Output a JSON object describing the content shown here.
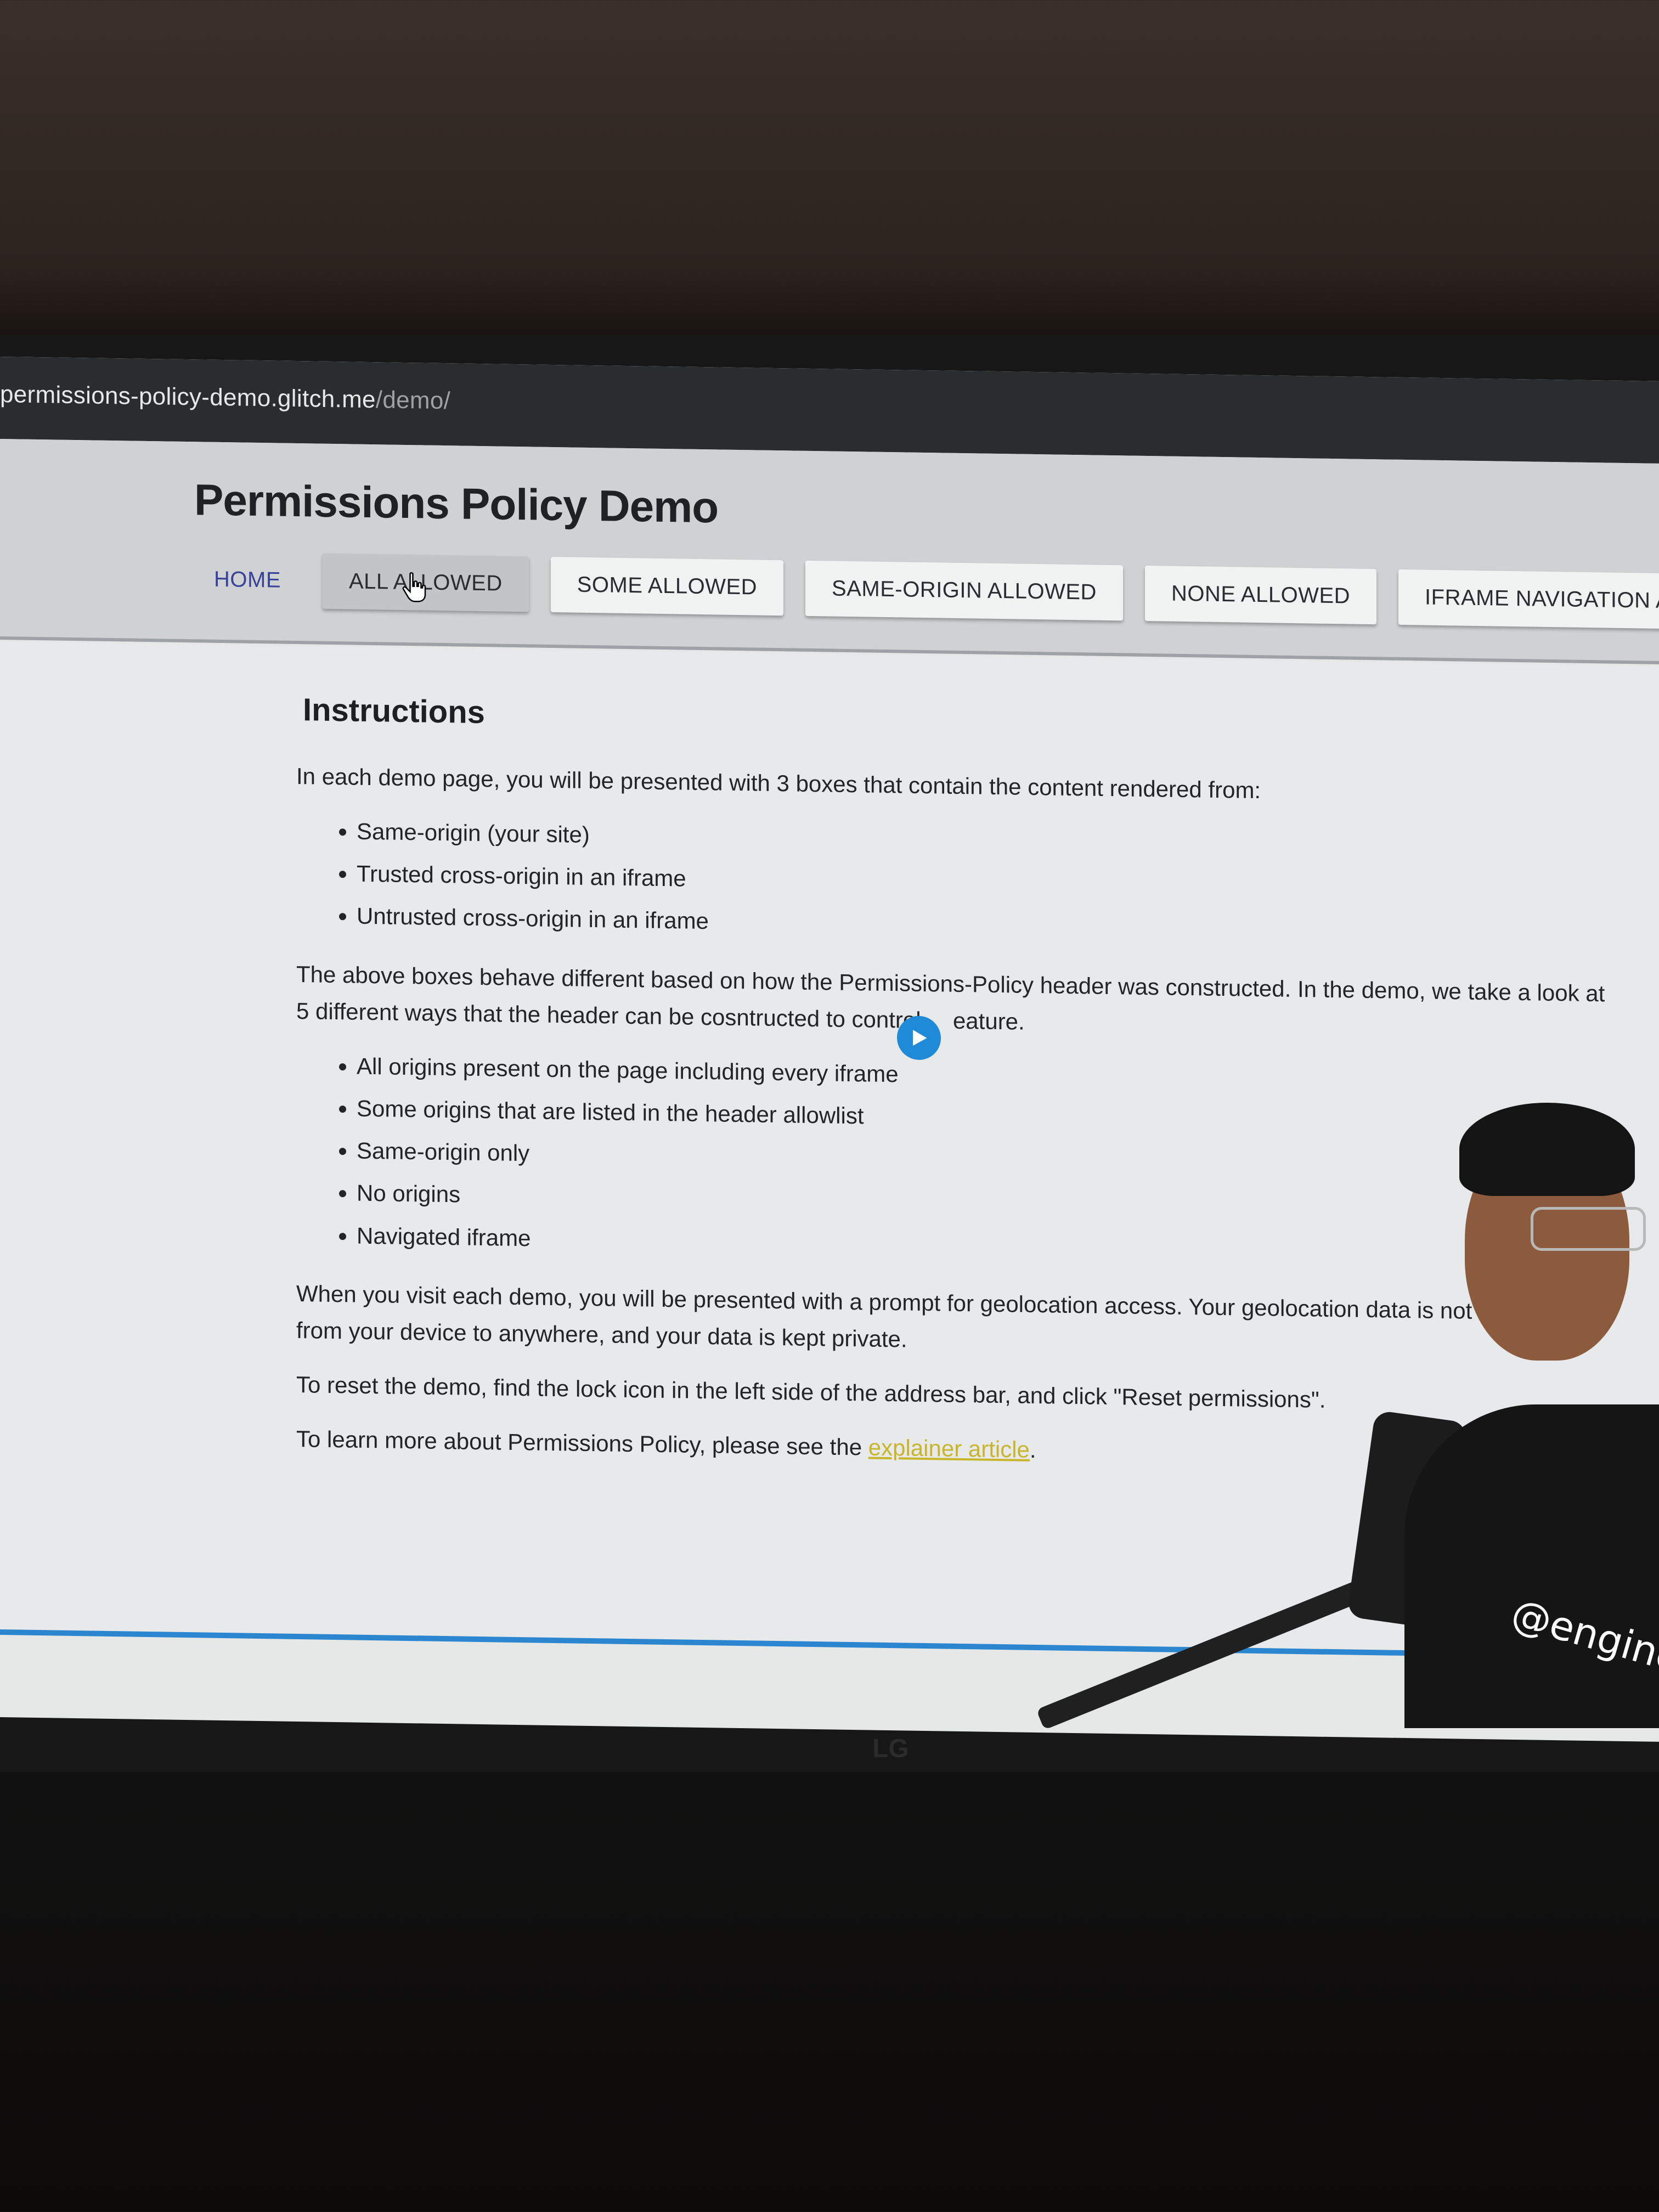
{
  "browser": {
    "url_host": "permissions-policy-demo.glitch.me",
    "url_path": "/demo/"
  },
  "header": {
    "title": "Permissions Policy Demo",
    "nav": [
      {
        "label": "HOME"
      },
      {
        "label": "ALL ALLOWED"
      },
      {
        "label": "SOME ALLOWED"
      },
      {
        "label": "SAME-ORIGIN ALLOWED"
      },
      {
        "label": "NONE ALLOWED"
      },
      {
        "label": "IFRAME NAVIGATION ALLOW"
      }
    ],
    "active_item": "ALL ALLOWED"
  },
  "main": {
    "heading": "Instructions",
    "intro": "In each demo page, you will be presented with 3 boxes that contain the content rendered from:",
    "boxes": [
      "Same-origin (your site)",
      "Trusted cross-origin in an iframe",
      "Untrusted cross-origin in an iframe"
    ],
    "para2_before": "The above boxes behave different based on how the Permissions-Policy header was constructed. In the demo, we take a look at 5 different ways that the header can be cosntructed to control",
    "para2_after": "eature.",
    "ways": [
      "All origins present on the page including every iframe",
      "Some origins that are listed in the header allowlist",
      "Same-origin only",
      "No origins",
      "Navigated iframe"
    ],
    "para3": "When you visit each demo, you will be presented with a prompt for geolocation access. Your geolocation data is not transmitted from your device to anywhere, and your data is kept private.",
    "para4": "To reset the demo, find the lock icon in the left side of the address bar, and click \"Reset permissions\".",
    "para5_before": "To learn more about Permissions Policy, please see the",
    "para5_link": "explainer article",
    "para5_after": "."
  },
  "overlay": {
    "handle": "@engineer",
    "monitor_brand": "LG"
  },
  "video": {
    "progress": 1.0
  },
  "colors": {
    "home_link": "#37429a",
    "link": "#c9b52c",
    "play_button": "#1e8ad8",
    "progress": "#2c86cf"
  }
}
